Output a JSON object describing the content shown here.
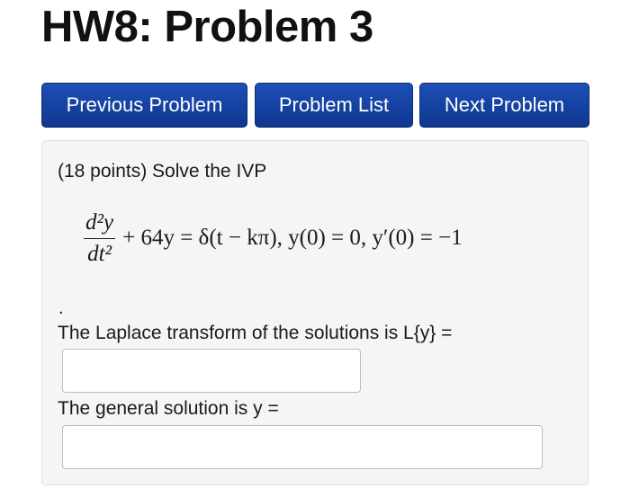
{
  "page": {
    "title": "HW8: Problem 3"
  },
  "nav": {
    "previous_label": "Previous Problem",
    "list_label": "Problem List",
    "next_label": "Next Problem"
  },
  "problem": {
    "prompt": "(18 points) Solve the IVP",
    "equation": {
      "numerator": "d²y",
      "denominator": "dt²",
      "rest": "+ 64y = δ(t − kπ), y(0) = 0, y′(0) = −1"
    },
    "trailing_dot": ".",
    "laplace_label": "The Laplace transform of the solutions is L{y} =",
    "laplace_value": "",
    "general_label": "The general solution is y =",
    "general_value": ""
  }
}
